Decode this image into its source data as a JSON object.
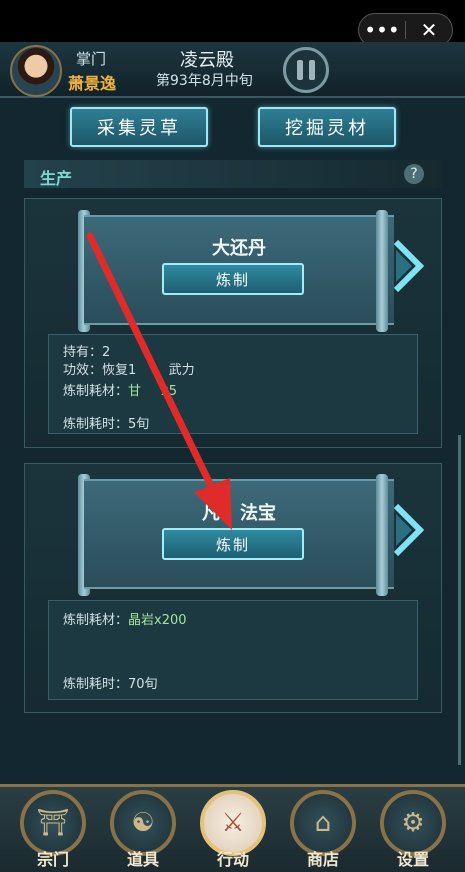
{
  "system_bar": {
    "more_icon": "•••",
    "close_icon": "✕"
  },
  "header": {
    "role_label": "掌门",
    "player_name": "萧景逸",
    "hall_name": "凌云殿",
    "date_text": "第93年8月中旬"
  },
  "actions": {
    "gather_label": "采集灵草",
    "dig_label": "挖掘灵材"
  },
  "section": {
    "title": "生产",
    "help_icon": "?"
  },
  "items": [
    {
      "name": "大还丹",
      "craft_label": "炼制",
      "held_line": "持有：2",
      "effect_line": "功效：恢复1",
      "effect_tail": "武力",
      "material_label": "炼制耗材：",
      "material_value": "甘",
      "material_tail": "x5",
      "time_line": "炼制耗时：5旬"
    },
    {
      "name_head": "凡",
      "name_tail": "法宝",
      "craft_label": "炼制",
      "material_label": "炼制耗材：",
      "material_value": "晶岩x200",
      "time_line": "炼制耗时：70旬"
    }
  ],
  "nav": [
    {
      "label": "宗门",
      "icon": "sect-icon"
    },
    {
      "label": "道具",
      "icon": "bag-icon"
    },
    {
      "label": "行动",
      "icon": "action-icon"
    },
    {
      "label": "商店",
      "icon": "shop-icon"
    },
    {
      "label": "设置",
      "icon": "gear-icon"
    }
  ],
  "colors": {
    "accent": "#9ee8f6",
    "gold": "#f1b33d",
    "annotation": "#e02b2b"
  }
}
